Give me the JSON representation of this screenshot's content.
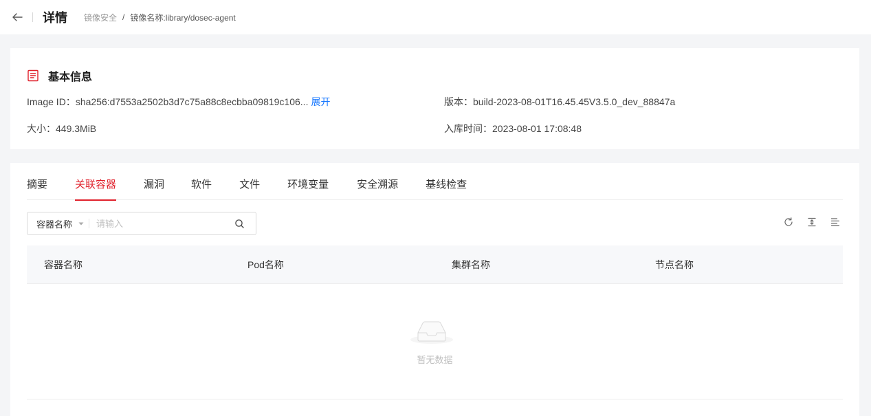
{
  "header": {
    "title": "详情",
    "breadcrumb": {
      "parent": "镜像安全",
      "separator": "/",
      "current": "镜像名称:library/dosec-agent"
    }
  },
  "basic_info": {
    "title": "基本信息",
    "image_id_label": "Image ID：",
    "image_id_value": "sha256:d7553a2502b3d7c75a88c8ecbba09819c106...",
    "expand_label": "展开",
    "version_label": "版本：",
    "version_value": "build-2023-08-01T16.45.45V3.5.0_dev_88847a",
    "size_label": "大小：",
    "size_value": "449.3MiB",
    "ingest_time_label": "入库时间：",
    "ingest_time_value": "2023-08-01 17:08:48"
  },
  "tabs": [
    {
      "label": "摘要",
      "active": false
    },
    {
      "label": "关联容器",
      "active": true
    },
    {
      "label": "漏洞",
      "active": false
    },
    {
      "label": "软件",
      "active": false
    },
    {
      "label": "文件",
      "active": false
    },
    {
      "label": "环境变量",
      "active": false
    },
    {
      "label": "安全溯源",
      "active": false
    },
    {
      "label": "基线检查",
      "active": false
    }
  ],
  "search": {
    "field_selected": "容器名称",
    "placeholder": "请输入"
  },
  "toolbar": {
    "icons": [
      "refresh-icon",
      "expand-vertical-icon",
      "column-settings-icon"
    ]
  },
  "table": {
    "columns": [
      "容器名称",
      "Pod名称",
      "集群名称",
      "节点名称"
    ],
    "rows": [],
    "empty_text": "暂无数据"
  },
  "colors": {
    "accent": "#e0202b",
    "link": "#1677ff"
  }
}
